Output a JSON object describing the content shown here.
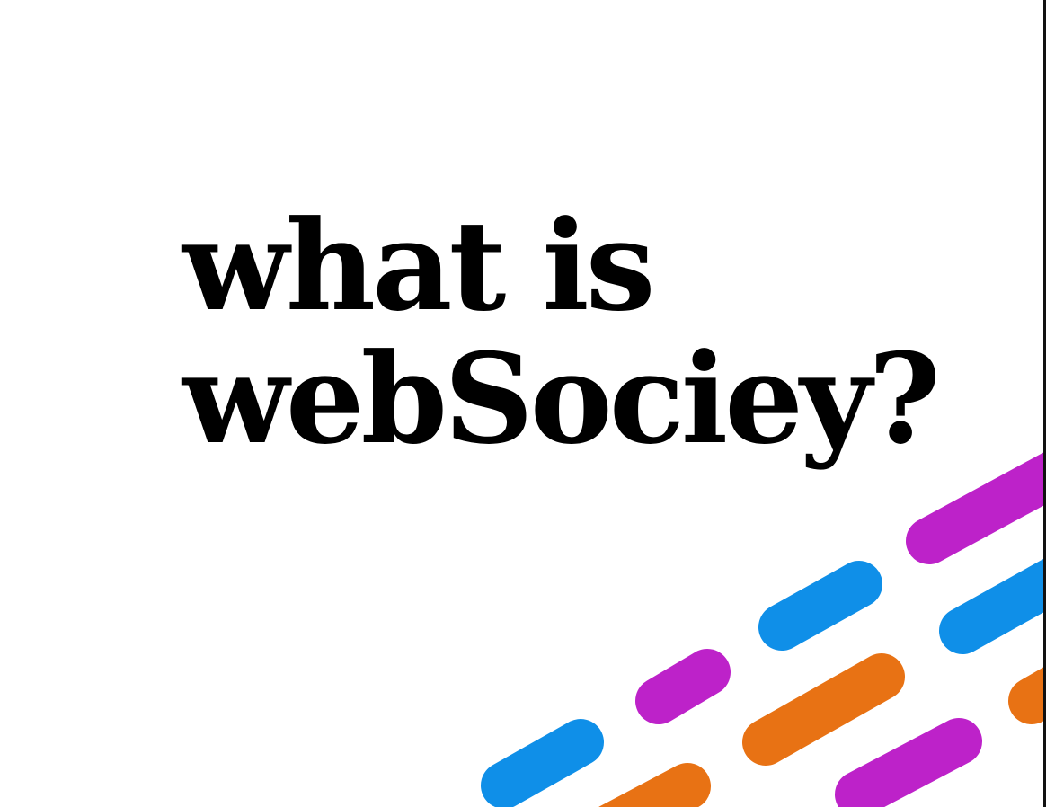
{
  "title": {
    "line1": "what is",
    "line2": "webSociey?"
  },
  "colors": {
    "background": "#ffffff",
    "text": "#000000",
    "magenta": "#bd22c9",
    "blue": "#0f8fe8",
    "orange": "#e87214"
  },
  "decoration": {
    "description_icon": "diagonal-rounded-stripes"
  }
}
